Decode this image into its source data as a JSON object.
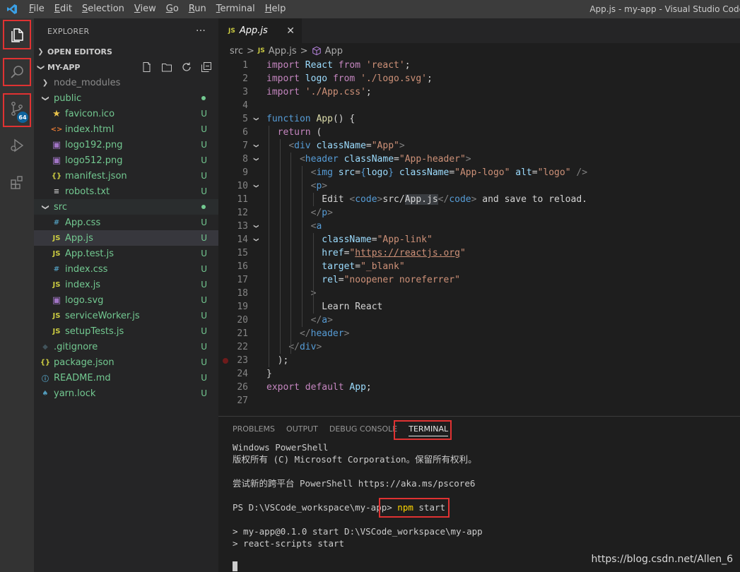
{
  "titlebar": {
    "menu": [
      "File",
      "Edit",
      "Selection",
      "View",
      "Go",
      "Run",
      "Terminal",
      "Help"
    ],
    "menu_underline": [
      "F",
      "E",
      "S",
      "V",
      "G",
      "R",
      "T",
      "H"
    ],
    "window_title": "App.js - my-app - Visual Studio Code"
  },
  "activity": {
    "items": [
      "explorer",
      "search",
      "source-control",
      "run-debug",
      "extensions"
    ],
    "scm_badge": "64"
  },
  "sidebar": {
    "title": "EXPLORER",
    "more": "···",
    "open_editors": "OPEN EDITORS",
    "folder": "MY-APP",
    "tree": [
      {
        "label": "node_modules",
        "depth": 1,
        "kind": "folder",
        "collapsed": true,
        "status": "",
        "grey": true
      },
      {
        "label": "public",
        "depth": 1,
        "kind": "folder",
        "collapsed": false,
        "status": "dot"
      },
      {
        "label": "favicon.ico",
        "depth": 2,
        "kind": "star",
        "status": "U"
      },
      {
        "label": "index.html",
        "depth": 2,
        "kind": "html",
        "status": "U"
      },
      {
        "label": "logo192.png",
        "depth": 2,
        "kind": "img",
        "status": "U"
      },
      {
        "label": "logo512.png",
        "depth": 2,
        "kind": "img",
        "status": "U"
      },
      {
        "label": "manifest.json",
        "depth": 2,
        "kind": "json",
        "status": "U"
      },
      {
        "label": "robots.txt",
        "depth": 2,
        "kind": "txt",
        "status": "U"
      },
      {
        "label": "src",
        "depth": 1,
        "kind": "folder",
        "collapsed": false,
        "status": "dot"
      },
      {
        "label": "App.css",
        "depth": 2,
        "kind": "css",
        "status": "U"
      },
      {
        "label": "App.js",
        "depth": 2,
        "kind": "js",
        "status": "U",
        "selected": true
      },
      {
        "label": "App.test.js",
        "depth": 2,
        "kind": "js",
        "status": "U"
      },
      {
        "label": "index.css",
        "depth": 2,
        "kind": "css",
        "status": "U"
      },
      {
        "label": "index.js",
        "depth": 2,
        "kind": "js",
        "status": "U"
      },
      {
        "label": "logo.svg",
        "depth": 2,
        "kind": "svg",
        "status": "U"
      },
      {
        "label": "serviceWorker.js",
        "depth": 2,
        "kind": "js",
        "status": "U"
      },
      {
        "label": "setupTests.js",
        "depth": 2,
        "kind": "js",
        "status": "U"
      },
      {
        "label": ".gitignore",
        "depth": 1,
        "kind": "git",
        "status": "U"
      },
      {
        "label": "package.json",
        "depth": 1,
        "kind": "json",
        "status": "U"
      },
      {
        "label": "README.md",
        "depth": 1,
        "kind": "info",
        "status": "U"
      },
      {
        "label": "yarn.lock",
        "depth": 1,
        "kind": "yarn",
        "status": "U"
      }
    ]
  },
  "editor": {
    "tab": {
      "icon": "JS",
      "label": "App.js",
      "close": "✕"
    },
    "breadcrumb": [
      "src",
      ">",
      "JS",
      "App.js",
      ">",
      "App"
    ],
    "lines": [
      {
        "n": "1",
        "fold": false,
        "tokens": [
          [
            "c",
            "import"
          ],
          [
            "w",
            " "
          ],
          [
            "v",
            "React"
          ],
          [
            "w",
            " "
          ],
          [
            "c",
            "from"
          ],
          [
            "w",
            " "
          ],
          [
            "s",
            "'react'"
          ],
          [
            "w",
            ";"
          ]
        ]
      },
      {
        "n": "2",
        "fold": false,
        "tokens": [
          [
            "c",
            "import"
          ],
          [
            "w",
            " "
          ],
          [
            "v",
            "logo"
          ],
          [
            "w",
            " "
          ],
          [
            "c",
            "from"
          ],
          [
            "w",
            " "
          ],
          [
            "s",
            "'./logo.svg'"
          ],
          [
            "w",
            ";"
          ]
        ]
      },
      {
        "n": "3",
        "fold": false,
        "tokens": [
          [
            "c",
            "import"
          ],
          [
            "w",
            " "
          ],
          [
            "s",
            "'./App.css'"
          ],
          [
            "w",
            ";"
          ]
        ]
      },
      {
        "n": "4",
        "fold": false,
        "tokens": []
      },
      {
        "n": "5",
        "fold": true,
        "tokens": [
          [
            "k",
            "function"
          ],
          [
            "w",
            " "
          ],
          [
            "f",
            "App"
          ],
          [
            "w",
            "() {"
          ]
        ]
      },
      {
        "n": "6",
        "fold": false,
        "tokens": [
          [
            "w",
            "  "
          ],
          [
            "c",
            "return"
          ],
          [
            "w",
            " ("
          ]
        ]
      },
      {
        "n": "7",
        "fold": true,
        "tokens": [
          [
            "w",
            "    "
          ],
          [
            "p",
            "<"
          ],
          [
            "t",
            "div"
          ],
          [
            "w",
            " "
          ],
          [
            "a",
            "className"
          ],
          [
            "w",
            "="
          ],
          [
            "s",
            "\"App\""
          ],
          [
            "p",
            ">"
          ]
        ]
      },
      {
        "n": "8",
        "fold": true,
        "tokens": [
          [
            "w",
            "      "
          ],
          [
            "p",
            "<"
          ],
          [
            "t",
            "header"
          ],
          [
            "w",
            " "
          ],
          [
            "a",
            "className"
          ],
          [
            "w",
            "="
          ],
          [
            "s",
            "\"App-header\""
          ],
          [
            "p",
            ">"
          ]
        ]
      },
      {
        "n": "9",
        "fold": false,
        "tokens": [
          [
            "w",
            "        "
          ],
          [
            "p",
            "<"
          ],
          [
            "t",
            "img"
          ],
          [
            "w",
            " "
          ],
          [
            "a",
            "src"
          ],
          [
            "w",
            "="
          ],
          [
            "k",
            "{"
          ],
          [
            "v",
            "logo"
          ],
          [
            "k",
            "}"
          ],
          [
            "w",
            " "
          ],
          [
            "a",
            "className"
          ],
          [
            "w",
            "="
          ],
          [
            "s",
            "\"App-logo\""
          ],
          [
            "w",
            " "
          ],
          [
            "a",
            "alt"
          ],
          [
            "w",
            "="
          ],
          [
            "s",
            "\"logo\""
          ],
          [
            "w",
            " "
          ],
          [
            "p",
            "/>"
          ]
        ]
      },
      {
        "n": "10",
        "fold": true,
        "tokens": [
          [
            "w",
            "        "
          ],
          [
            "p",
            "<"
          ],
          [
            "t",
            "p"
          ],
          [
            "p",
            ">"
          ]
        ]
      },
      {
        "n": "11",
        "fold": false,
        "tokens": [
          [
            "w",
            "          Edit "
          ],
          [
            "p",
            "<"
          ],
          [
            "t",
            "code"
          ],
          [
            "p",
            ">"
          ],
          [
            "w",
            "src/"
          ],
          [
            "hl",
            "App.js"
          ],
          [
            "p",
            "</"
          ],
          [
            "t",
            "code"
          ],
          [
            "p",
            ">"
          ],
          [
            "w",
            " and save to reload."
          ]
        ]
      },
      {
        "n": "12",
        "fold": false,
        "tokens": [
          [
            "w",
            "        "
          ],
          [
            "p",
            "</"
          ],
          [
            "t",
            "p"
          ],
          [
            "p",
            ">"
          ]
        ]
      },
      {
        "n": "13",
        "fold": true,
        "tokens": [
          [
            "w",
            "        "
          ],
          [
            "p",
            "<"
          ],
          [
            "t",
            "a"
          ]
        ]
      },
      {
        "n": "14",
        "fold": true,
        "tokens": [
          [
            "w",
            "          "
          ],
          [
            "a",
            "className"
          ],
          [
            "w",
            "="
          ],
          [
            "s",
            "\"App-link\""
          ]
        ]
      },
      {
        "n": "15",
        "fold": false,
        "tokens": [
          [
            "w",
            "          "
          ],
          [
            "a",
            "href"
          ],
          [
            "w",
            "="
          ],
          [
            "s",
            "\""
          ],
          [
            "u",
            "https://reactjs.org"
          ],
          [
            "s",
            "\""
          ]
        ]
      },
      {
        "n": "16",
        "fold": false,
        "tokens": [
          [
            "w",
            "          "
          ],
          [
            "a",
            "target"
          ],
          [
            "w",
            "="
          ],
          [
            "s",
            "\"_blank\""
          ]
        ]
      },
      {
        "n": "17",
        "fold": false,
        "tokens": [
          [
            "w",
            "          "
          ],
          [
            "a",
            "rel"
          ],
          [
            "w",
            "="
          ],
          [
            "s",
            "\"noopener noreferrer\""
          ]
        ]
      },
      {
        "n": "18",
        "fold": false,
        "tokens": [
          [
            "w",
            "        "
          ],
          [
            "p",
            ">"
          ]
        ]
      },
      {
        "n": "19",
        "fold": false,
        "tokens": [
          [
            "w",
            "          Learn React"
          ]
        ]
      },
      {
        "n": "20",
        "fold": false,
        "tokens": [
          [
            "w",
            "        "
          ],
          [
            "p",
            "</"
          ],
          [
            "t",
            "a"
          ],
          [
            "p",
            ">"
          ]
        ]
      },
      {
        "n": "21",
        "fold": false,
        "tokens": [
          [
            "w",
            "      "
          ],
          [
            "p",
            "</"
          ],
          [
            "t",
            "header"
          ],
          [
            "p",
            ">"
          ]
        ]
      },
      {
        "n": "22",
        "fold": false,
        "tokens": [
          [
            "w",
            "    "
          ],
          [
            "p",
            "</"
          ],
          [
            "t",
            "div"
          ],
          [
            "p",
            ">"
          ]
        ]
      },
      {
        "n": "23",
        "fold": false,
        "bp": true,
        "tokens": [
          [
            "w",
            "  );"
          ]
        ]
      },
      {
        "n": "24",
        "fold": false,
        "tokens": [
          [
            "w",
            "}"
          ]
        ]
      },
      {
        "n": "26",
        "fold": false,
        "tokens": [
          [
            "c",
            "export"
          ],
          [
            "w",
            " "
          ],
          [
            "c",
            "default"
          ],
          [
            "w",
            " "
          ],
          [
            "v",
            "App"
          ],
          [
            "w",
            ";"
          ]
        ]
      },
      {
        "n": "27",
        "fold": false,
        "tokens": []
      }
    ]
  },
  "panel": {
    "tabs": [
      "PROBLEMS",
      "OUTPUT",
      "DEBUG CONSOLE",
      "TERMINAL"
    ],
    "active_tab": "TERMINAL",
    "terminal": [
      "Windows PowerShell",
      "版权所有 (C) Microsoft Corporation。保留所有权利。",
      "",
      "尝试新的跨平台 PowerShell https://aka.ms/pscore6",
      "",
      "PS D:\\VSCode_workspace\\my-app> ",
      "",
      "> my-app@0.1.0 start D:\\VSCode_workspace\\my-app",
      "> react-scripts start"
    ],
    "command_keyword": "npm",
    "command_rest": " start"
  },
  "watermark": "https://blog.csdn.net/Allen_6",
  "colors": {
    "highlight_box": "#e03232",
    "untracked": "#73c991",
    "js_icon": "#cbcb41"
  }
}
